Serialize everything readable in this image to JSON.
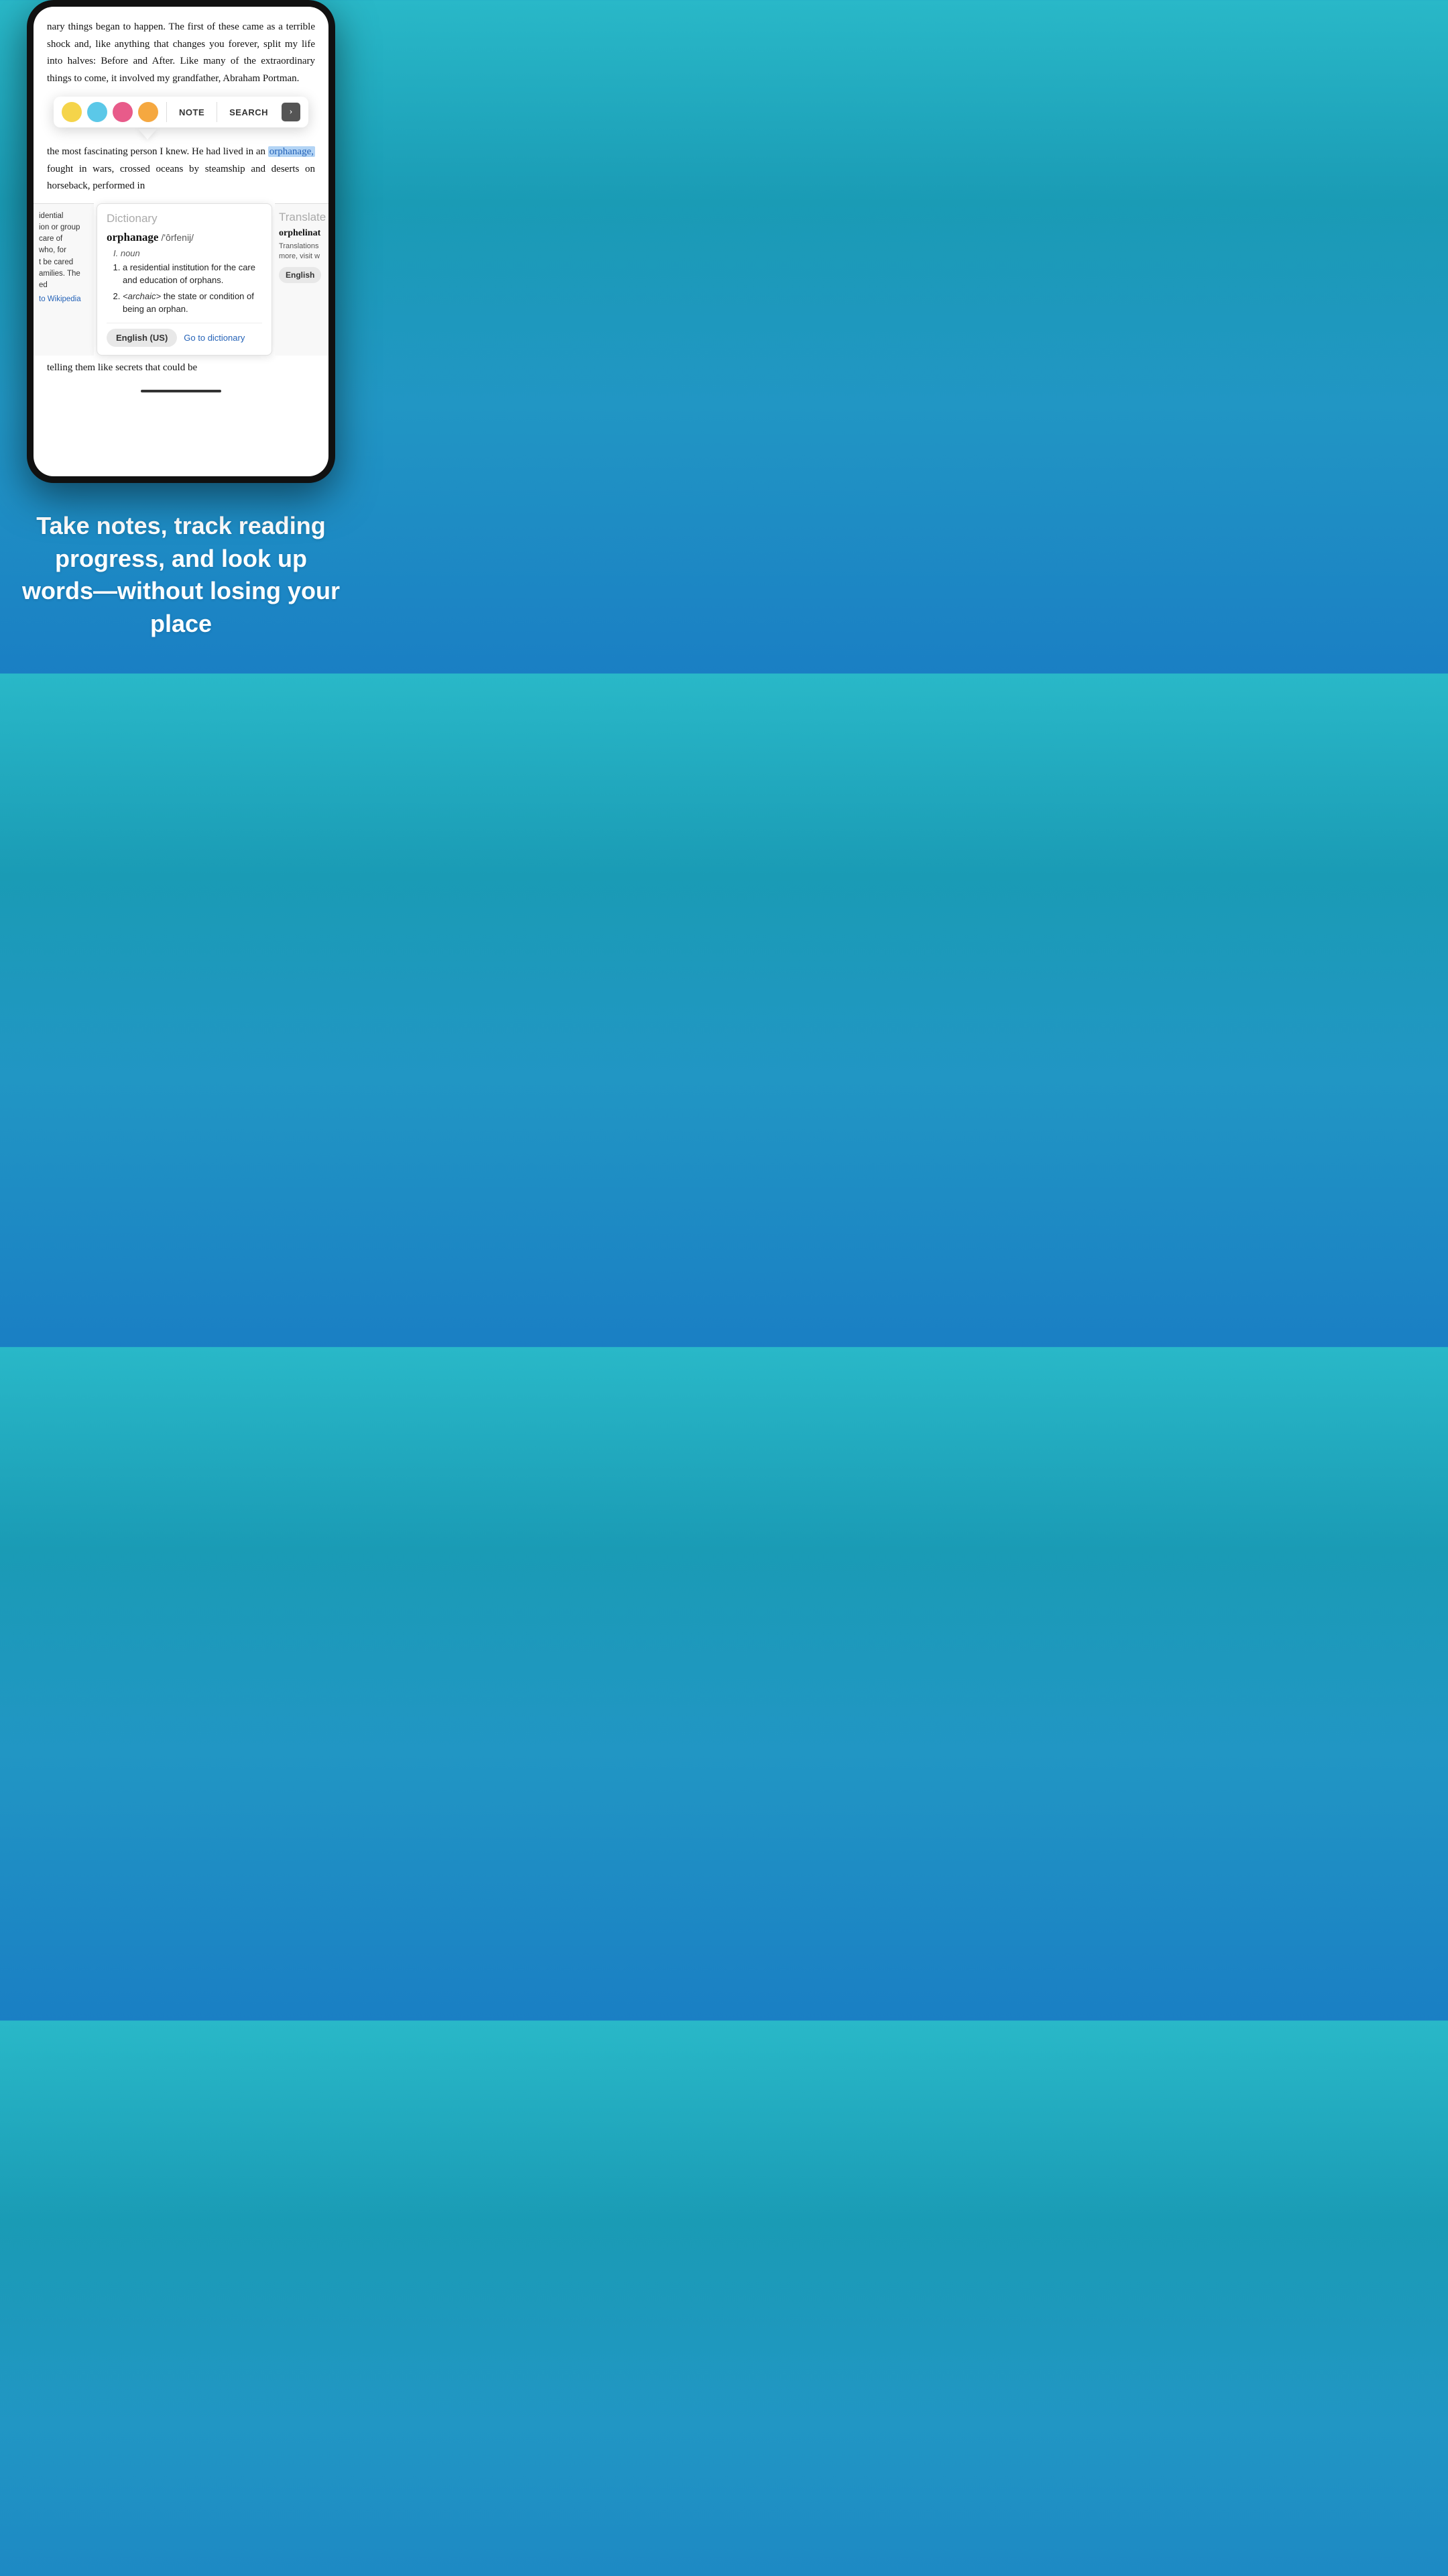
{
  "phone": {
    "book_text_top": "nary things began to happen. The first of these came as a terrible shock and, like anything that changes you forever, split my life into halves: Before and After. Like many of the extraordinary things to come, it involved my grandfather, Abraham Portman.",
    "book_text_mid": "the most fascinating person I knew. He had lived in an",
    "highlighted_word": "orphanage,",
    "book_text_mid2": "fought in wars, crossed oceans by steamship and deserts on horseback, performed in",
    "book_text_bottom": "telling them like secrets that could be"
  },
  "toolbar": {
    "color1": "#f5d44a",
    "color2": "#5bc8e8",
    "color3": "#e85b8a",
    "color4": "#f5a840",
    "note_label": "NOTE",
    "search_label": "SEARCH",
    "arrow_label": "›"
  },
  "left_panel": {
    "text_lines": [
      "idential",
      "ion or group",
      "care of",
      "who, for",
      "t be cared",
      "amilies. The",
      "ed"
    ],
    "link_text": "to Wikipedia"
  },
  "dictionary": {
    "panel_title": "Dictionary",
    "word": "orphanage",
    "phonetic": "/'ôrfenij/",
    "pos": "noun",
    "definitions": [
      "a residential institution for the care and education of orphans.",
      "<archaic> the state or condition of being an orphan."
    ],
    "lang_button": "English (US)",
    "go_to_label": "Go to dictionary"
  },
  "right_panel": {
    "title": "Translate",
    "word": "orphelinat",
    "desc": "Translations more, visit w",
    "lang_button": "English"
  },
  "tagline": {
    "text": "Take notes, track reading progress, and look up words—without losing your place"
  }
}
